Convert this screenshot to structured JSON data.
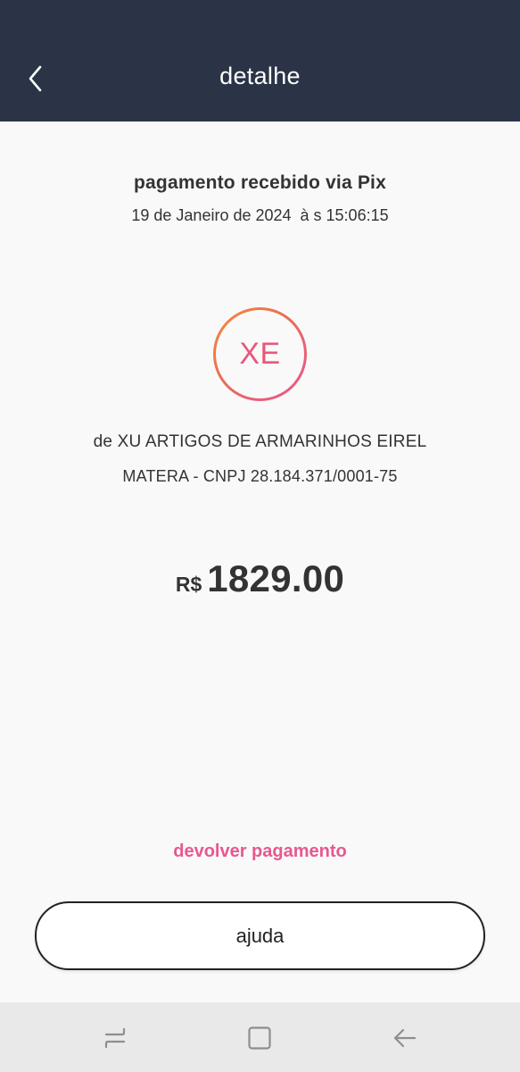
{
  "header": {
    "title": "detalhe",
    "back_icon": "chevron-left-icon"
  },
  "transaction": {
    "title": "pagamento recebido via Pix",
    "datetime": "19 de Janeiro de 2024  à s 15:06:15"
  },
  "payer": {
    "initials": "XE",
    "name": "de XU ARTIGOS DE ARMARINHOS EIREL",
    "bank_info": "MATERA - CNPJ 28.184.371/0001-75"
  },
  "amount": {
    "currency": "R$",
    "value": "1829.00"
  },
  "actions": {
    "refund_label": "devolver pagamento",
    "help_label": "ajuda"
  },
  "navbar": {
    "recent_icon": "recent-apps-icon",
    "home_icon": "home-square-icon",
    "back_icon": "back-arrow-icon"
  },
  "colors": {
    "header_bg": "#2a3446",
    "accent_pink": "#e8588e",
    "avatar_gradient_start": "#f28c38",
    "avatar_gradient_end": "#e3588f",
    "page_bg": "#f9f9f9",
    "navbar_bg": "#e9e9e9"
  }
}
